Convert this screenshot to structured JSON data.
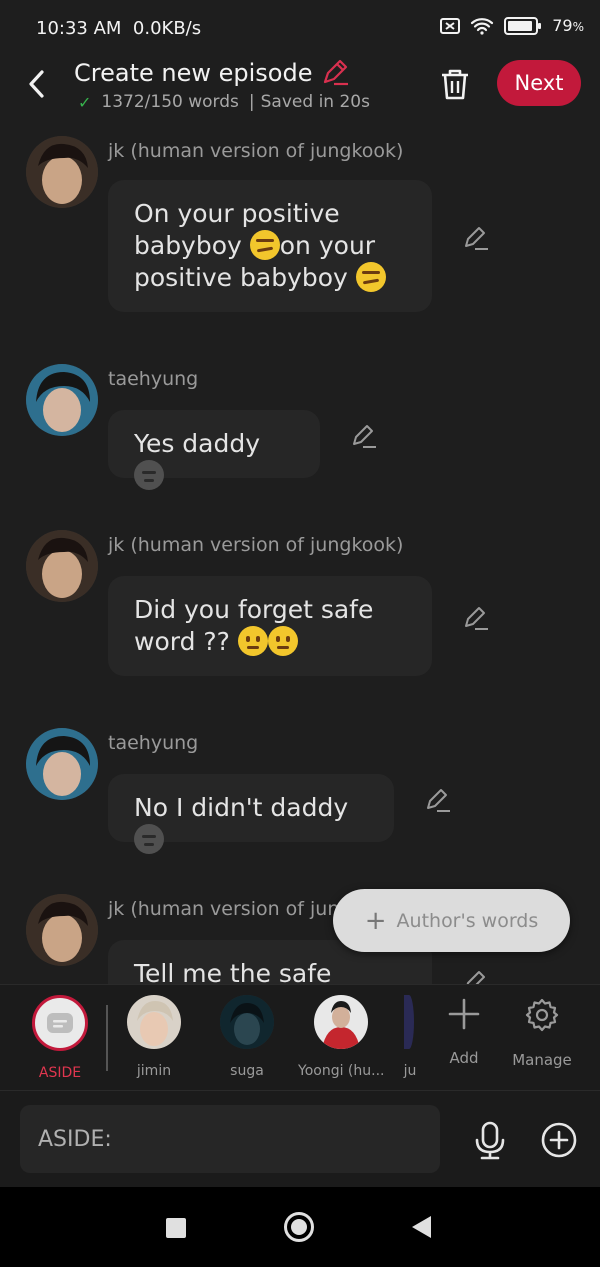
{
  "status_bar": {
    "time": "10:33 AM",
    "speed": "0.0KB/s",
    "battery": "79",
    "battery_unit": "%"
  },
  "header": {
    "title": "Create new episode",
    "word_count": "1372/150 words",
    "separator": "|",
    "saved": "Saved in 20s",
    "next_label": "Next"
  },
  "messages": [
    {
      "author": "jk (human version of jungkook)",
      "text_parts": [
        "On your positive",
        "babyboy ",
        "on your",
        "positive babyboy "
      ],
      "emoji": "smirk"
    },
    {
      "author": "taehyung",
      "text_parts": [
        "Yes daddy "
      ],
      "emoji": "new-moon"
    },
    {
      "author": "jk (human version of jungkook)",
      "text_parts": [
        "Did you forget safe",
        "word ?? "
      ],
      "emoji": "worried"
    },
    {
      "author": "taehyung",
      "text_parts": [
        "No I didn't daddy "
      ],
      "emoji": "new-moon"
    },
    {
      "author": "jk (human version of jun",
      "text_parts": [
        "Tell me the safe word!!"
      ],
      "emoji": ""
    }
  ],
  "authors_words": {
    "label": "Author's words"
  },
  "characters": [
    {
      "label": "ASIDE"
    },
    {
      "label": "jimin"
    },
    {
      "label": "suga"
    },
    {
      "label": "Yoongi (hu..."
    },
    {
      "label": "ju"
    }
  ],
  "tools": {
    "add_label": "Add",
    "manage_label": "Manage"
  },
  "input": {
    "placeholder": "ASIDE:"
  },
  "colors": {
    "accent": "#c2193b",
    "background": "#1e1e1e",
    "bubble": "#262626"
  }
}
